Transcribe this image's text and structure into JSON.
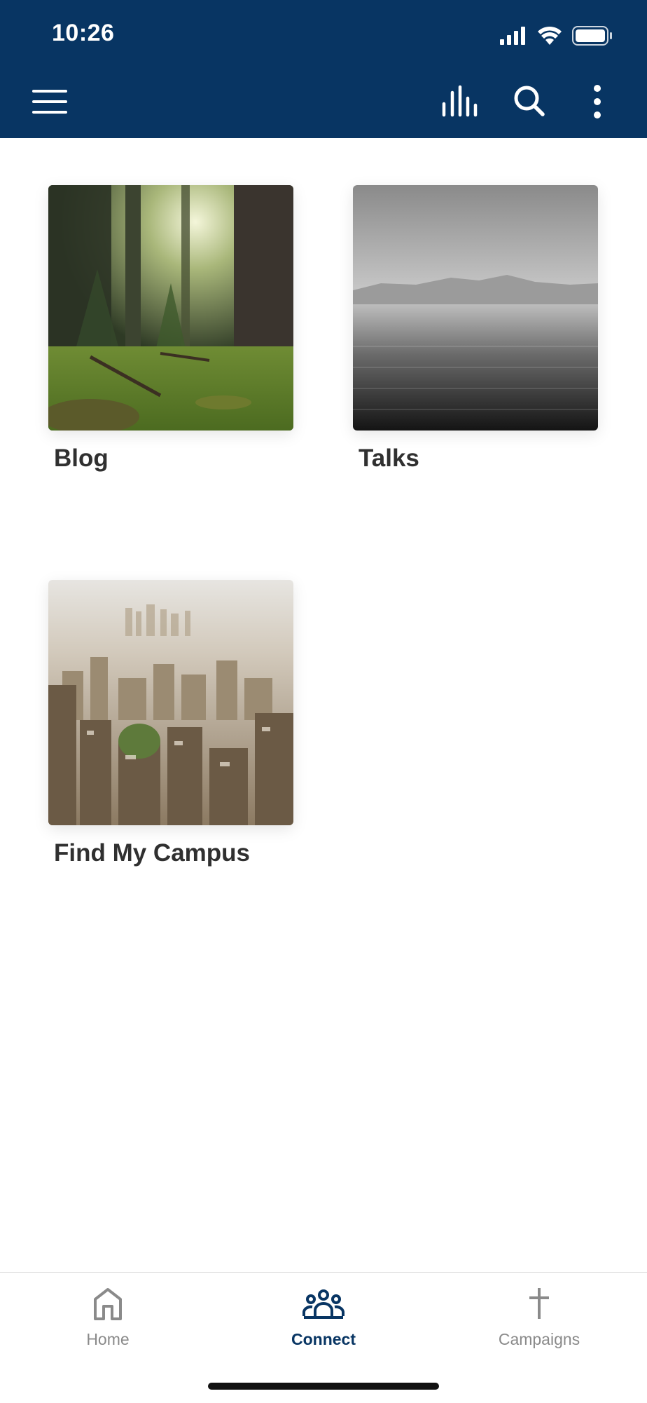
{
  "status_bar": {
    "time": "10:26"
  },
  "toolbar": {
    "icons": [
      "menu-icon",
      "audio-bars-icon",
      "search-icon",
      "more-vertical-icon"
    ]
  },
  "content": {
    "cards": [
      {
        "label": "Blog",
        "image": "forest-photo"
      },
      {
        "label": "Talks",
        "image": "lake-mountains-photo"
      },
      {
        "label": "Find My Campus",
        "image": "city-aerial-photo"
      }
    ]
  },
  "tab_bar": {
    "tabs": [
      {
        "label": "Home",
        "icon": "home-icon",
        "active": false
      },
      {
        "label": "Connect",
        "icon": "people-icon",
        "active": true
      },
      {
        "label": "Campaigns",
        "icon": "cross-icon",
        "active": false
      }
    ]
  },
  "colors": {
    "brand": "#083563",
    "inactive_tab": "#8a8a8a",
    "label_text": "#303030"
  }
}
